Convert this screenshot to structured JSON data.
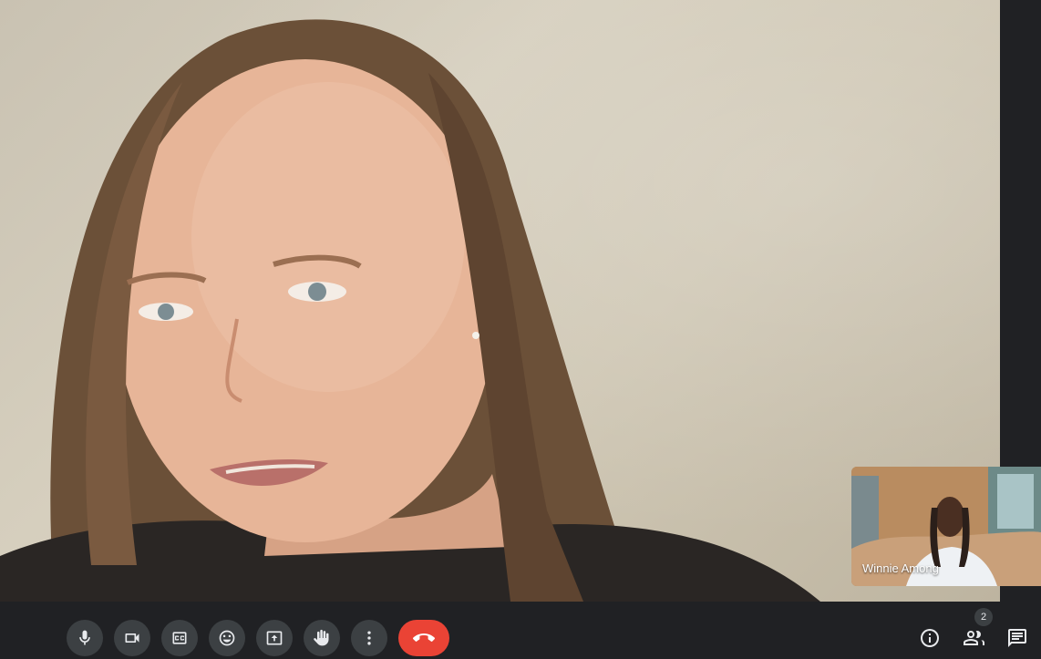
{
  "main_video": {
    "speaker_name": ""
  },
  "self_view": {
    "name": "Winnie Among"
  },
  "controls": [
    {
      "name": "mic-button",
      "icon": "microphone-icon"
    },
    {
      "name": "camera-button",
      "icon": "video-camera-icon"
    },
    {
      "name": "captions-button",
      "icon": "closed-captions-icon"
    },
    {
      "name": "reactions-button",
      "icon": "emoji-icon"
    },
    {
      "name": "present-button",
      "icon": "present-screen-icon"
    },
    {
      "name": "raise-hand-button",
      "icon": "hand-icon"
    },
    {
      "name": "more-options-button",
      "icon": "more-vertical-icon"
    },
    {
      "name": "end-call-button",
      "icon": "phone-hangup-icon"
    }
  ],
  "right_controls": {
    "info_icon": "info-icon",
    "people_icon": "people-icon",
    "people_count": "2",
    "chat_icon": "chat-icon"
  },
  "colors": {
    "end_call": "#ea4335",
    "bar_bg": "#202124",
    "button_bg": "#3c4043"
  }
}
